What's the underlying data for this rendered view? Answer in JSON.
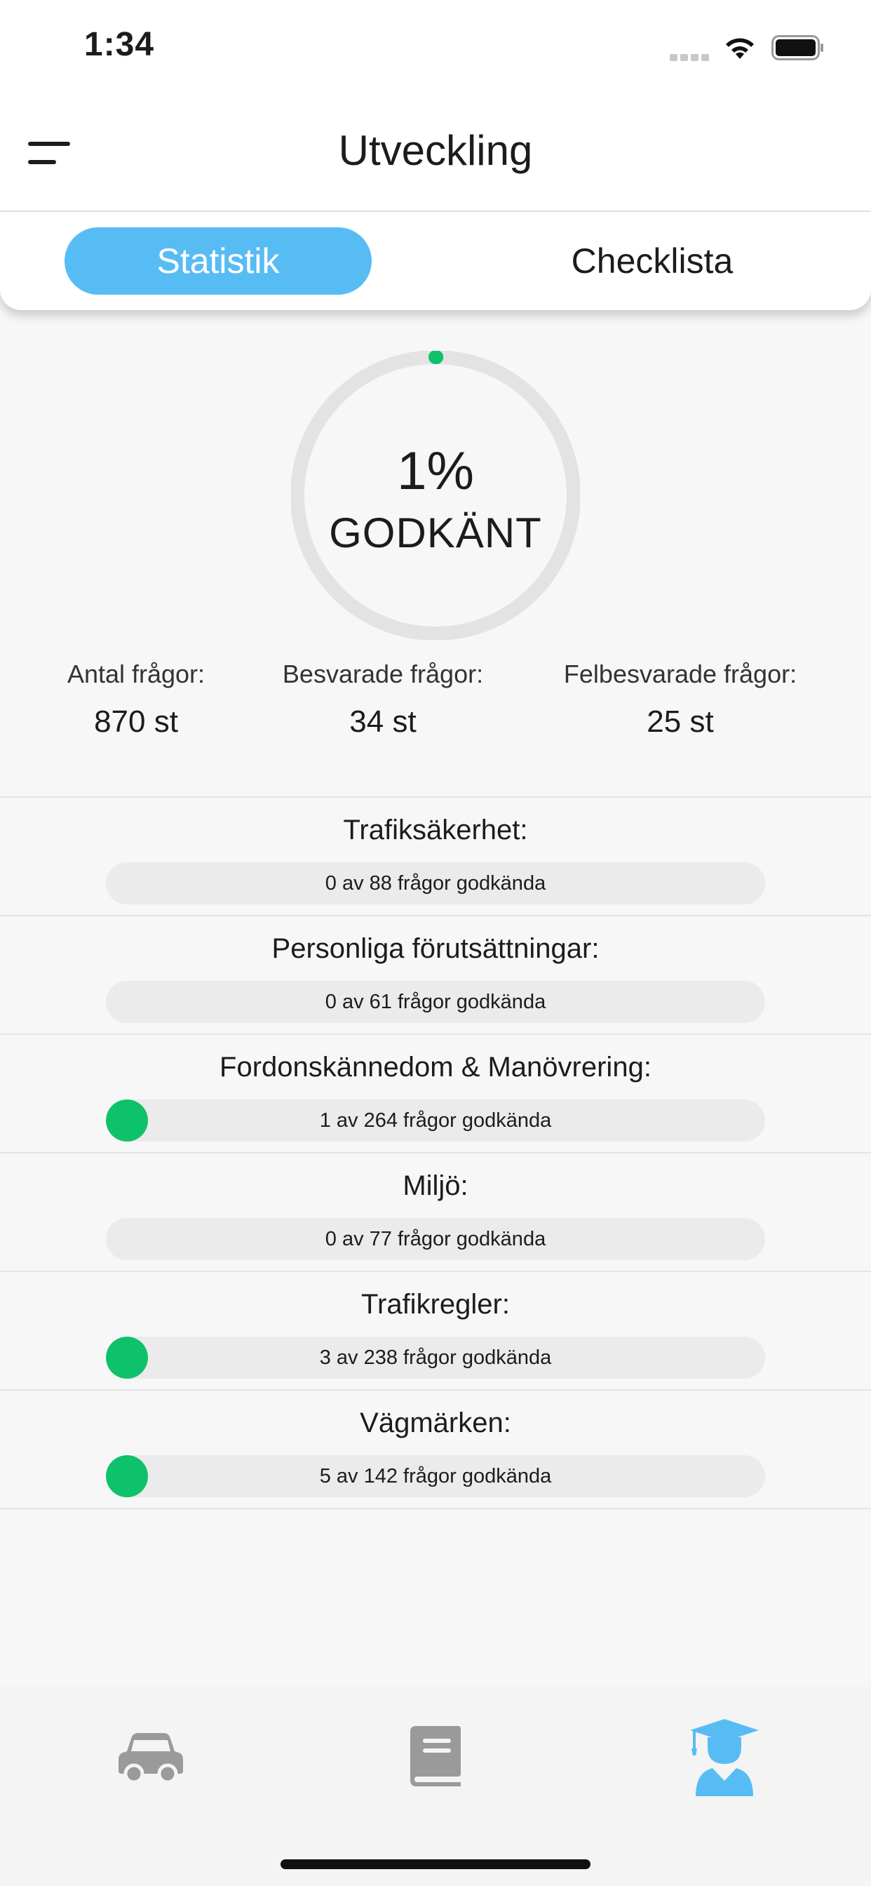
{
  "status_bar": {
    "time": "1:34"
  },
  "header": {
    "title": "Utveckling"
  },
  "tabs": [
    {
      "label": "Statistik",
      "active": true
    },
    {
      "label": "Checklista",
      "active": false
    }
  ],
  "progress": {
    "percent_text": "1%",
    "status_label": "GODKÄNT",
    "value": 0.01
  },
  "stats": [
    {
      "label": "Antal frågor:",
      "value": "870 st"
    },
    {
      "label": "Besvarade frågor:",
      "value": "34 st"
    },
    {
      "label": "Felbesvarade frågor:",
      "value": "25 st"
    }
  ],
  "categories": [
    {
      "title": "Trafiksäkerhet:",
      "text": "0 av 88 frågor godkända",
      "passed": 0,
      "total": 88
    },
    {
      "title": "Personliga förutsättningar:",
      "text": "0 av 61 frågor godkända",
      "passed": 0,
      "total": 61
    },
    {
      "title": "Fordonskännedom & Manövrering:",
      "text": "1 av 264 frågor godkända",
      "passed": 1,
      "total": 264
    },
    {
      "title": "Miljö:",
      "text": "0 av 77 frågor godkända",
      "passed": 0,
      "total": 77
    },
    {
      "title": "Trafikregler:",
      "text": "3 av 238 frågor godkända",
      "passed": 3,
      "total": 238
    },
    {
      "title": "Vägmärken:",
      "text": "5 av 142 frågor godkända",
      "passed": 5,
      "total": 142
    }
  ],
  "bottom_tabs": [
    {
      "icon": "car-icon",
      "active": false
    },
    {
      "icon": "book-icon",
      "active": false
    },
    {
      "icon": "graduate-icon",
      "active": true
    }
  ],
  "colors": {
    "accent": "#58bcf4",
    "success": "#0ec26b",
    "track": "#e3e3e3",
    "inactive_icon": "#9a9a9a"
  }
}
